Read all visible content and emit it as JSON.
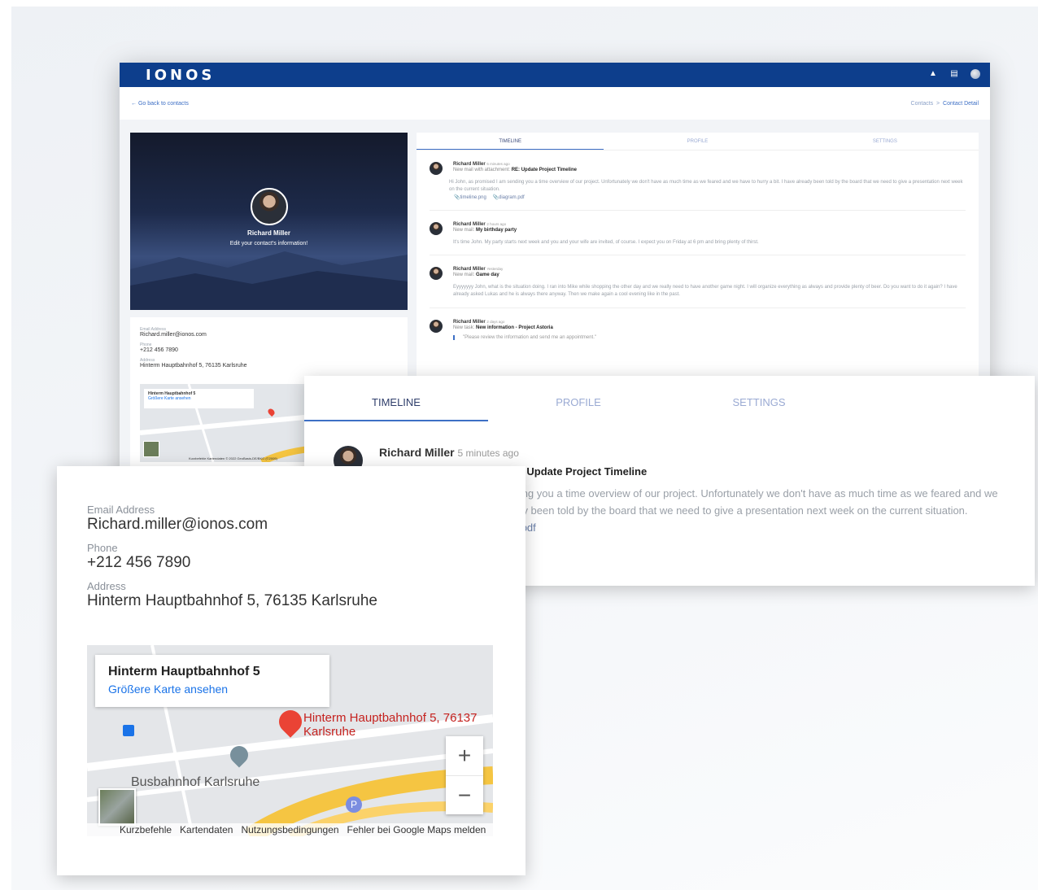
{
  "app": {
    "logo": "IONOS"
  },
  "subbar": {
    "back": "Go back to contacts",
    "crumb_1": "Contacts",
    "crumb_sep": ">",
    "crumb_2": "Contact Detail"
  },
  "hero": {
    "name": "Richard Miller",
    "subtitle": "Edit your contact's information!"
  },
  "contact": {
    "email_label": "Email Address",
    "email": "Richard.miller@ionos.com",
    "phone_label": "Phone",
    "phone": "+212 456 7890",
    "address_label": "Address",
    "address": "Hinterm Hauptbahnhof 5, 76135 Karlsruhe"
  },
  "tabs": [
    "TIMELINE",
    "PROFILE",
    "SETTINGS"
  ],
  "timeline": [
    {
      "name": "Richard Miller",
      "time": "5 minutes ago",
      "kind": "New mail with attachment:",
      "subject": "RE: Update Project Timeline",
      "body": "Hi John, as promised I am sending you a time overview of our project. Unfortunately we don't have as much time as we feared and we have to hurry a bit. I have already been told by the board that we need to give a presentation next week on the current situation.",
      "att1": "timeline.png",
      "att2": "diagram.pdf"
    },
    {
      "name": "Richard Miller",
      "time": "2 hours ago",
      "kind": "New mail:",
      "subject": "My birthday party",
      "body": "It's time John. My party starts next week and you and your wife are invited, of course. I expect you on Friday at 6 pm and bring plenty of thirst."
    },
    {
      "name": "Richard Miller",
      "time": "Yesterday",
      "kind": "New mail:",
      "subject": "Game day",
      "body": "Eyyyyyyy John, what is the situation doing. I ran into Mike while shopping the other day and we really need to have another game night. I will organize everything as always and provide plenty of beer. Do you want to do it again? I have already asked Lukas and he is always there anyway. Then we make again a cool evening like in the past."
    },
    {
      "name": "Richard Miller",
      "time": "2 days ago",
      "kind": "New task:",
      "subject": "New information - Project Astoria",
      "quote": "\"Please review the information and send me an appointment.\""
    }
  ],
  "map": {
    "place": "Hinterm Hauptbahnhof 5",
    "link": "Größere Karte ansehen",
    "pin": "Hinterm Hauptbahnhof 5, 76137 Karlsruhe",
    "bus": "Busbahnhof Karlsruhe",
    "plus": "+",
    "minus": "−",
    "footer": [
      "Kurzbefehle",
      "Kartendaten",
      "Nutzungsbedingungen",
      "Fehler bei Google Maps melden"
    ],
    "mini_footer": "Kurzbefehle   Kartendaten © 2022 GeoBasis-DE/BKG (©2009)"
  }
}
